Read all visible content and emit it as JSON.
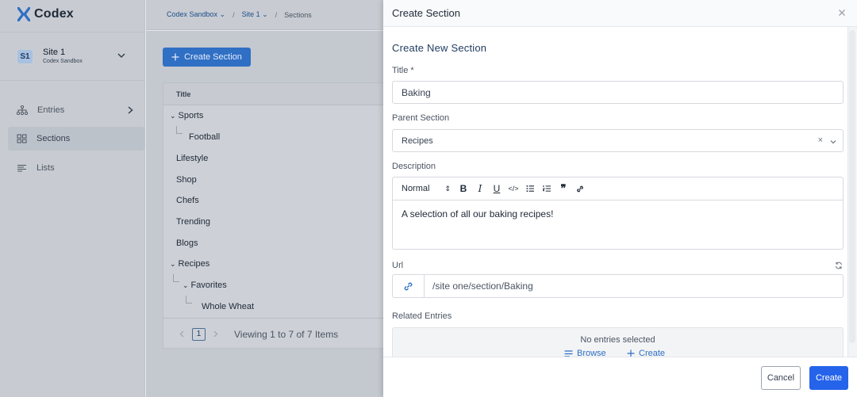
{
  "app": {
    "name": "Codex"
  },
  "site": {
    "badge": "S1",
    "name": "Site 1",
    "org": "Codex Sandbox"
  },
  "nav": [
    {
      "label": "Entries",
      "icon": "hierarchy-icon"
    },
    {
      "label": "Sections",
      "icon": "layout-icon"
    },
    {
      "label": "Lists",
      "icon": "list-icon"
    }
  ],
  "breadcrumb": {
    "org": "Codex Sandbox",
    "site": "Site 1",
    "page": "Sections",
    "separator": "/"
  },
  "main": {
    "create_button": "Create Section",
    "column_title": "Title",
    "rows": [
      {
        "label": "Sports"
      },
      {
        "label": "Football"
      },
      {
        "label": "Lifestyle"
      },
      {
        "label": "Shop"
      },
      {
        "label": "Chefs"
      },
      {
        "label": "Trending"
      },
      {
        "label": "Blogs"
      },
      {
        "label": "Recipes"
      },
      {
        "label": "Favorites"
      },
      {
        "label": "Whole Wheat"
      }
    ],
    "pager": {
      "page": "1",
      "summary": "Viewing 1 to 7 of 7 Items"
    }
  },
  "drawer": {
    "title": "Create Section",
    "heading": "Create New Section",
    "title_label": "Title *",
    "title_value": "Baking",
    "parent_label": "Parent Section",
    "parent_value": "Recipes",
    "parent_clear": "×",
    "description_label": "Description",
    "format_value": "Normal",
    "description_text": "A selection of all our baking recipes!",
    "url_label": "Url",
    "url_value": "/site one/section/Baking",
    "related_label": "Related Entries",
    "related_empty": "No entries selected",
    "browse_label": "Browse",
    "create_label": "Create",
    "cancel_button": "Cancel",
    "submit_button": "Create"
  },
  "colors": {
    "accent": "#2563eb",
    "brand": "#2f6fc4",
    "overlay": "#c4c8cf"
  }
}
